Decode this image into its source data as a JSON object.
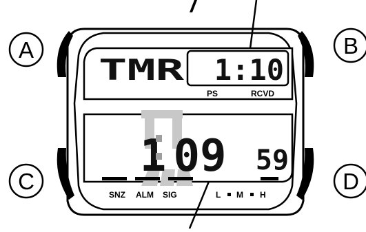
{
  "buttons": {
    "a": "A",
    "b": "B",
    "c": "C",
    "d": "D"
  },
  "upper_display": {
    "mode": "TMR",
    "value": "1:10",
    "label_ps": "PS",
    "label_rcvd": "RCVD"
  },
  "lower_display": {
    "hour": "1",
    "minute": "09",
    "seconds": "59"
  },
  "indicators": {
    "snz": "SNZ",
    "alm": "ALM",
    "sig": "SIG",
    "l": "L",
    "m": "M",
    "h": "H"
  },
  "colors": {
    "outline": "#000000",
    "flash_gray": "#c8c8c8",
    "colon_gray": "#9e9e9e"
  }
}
